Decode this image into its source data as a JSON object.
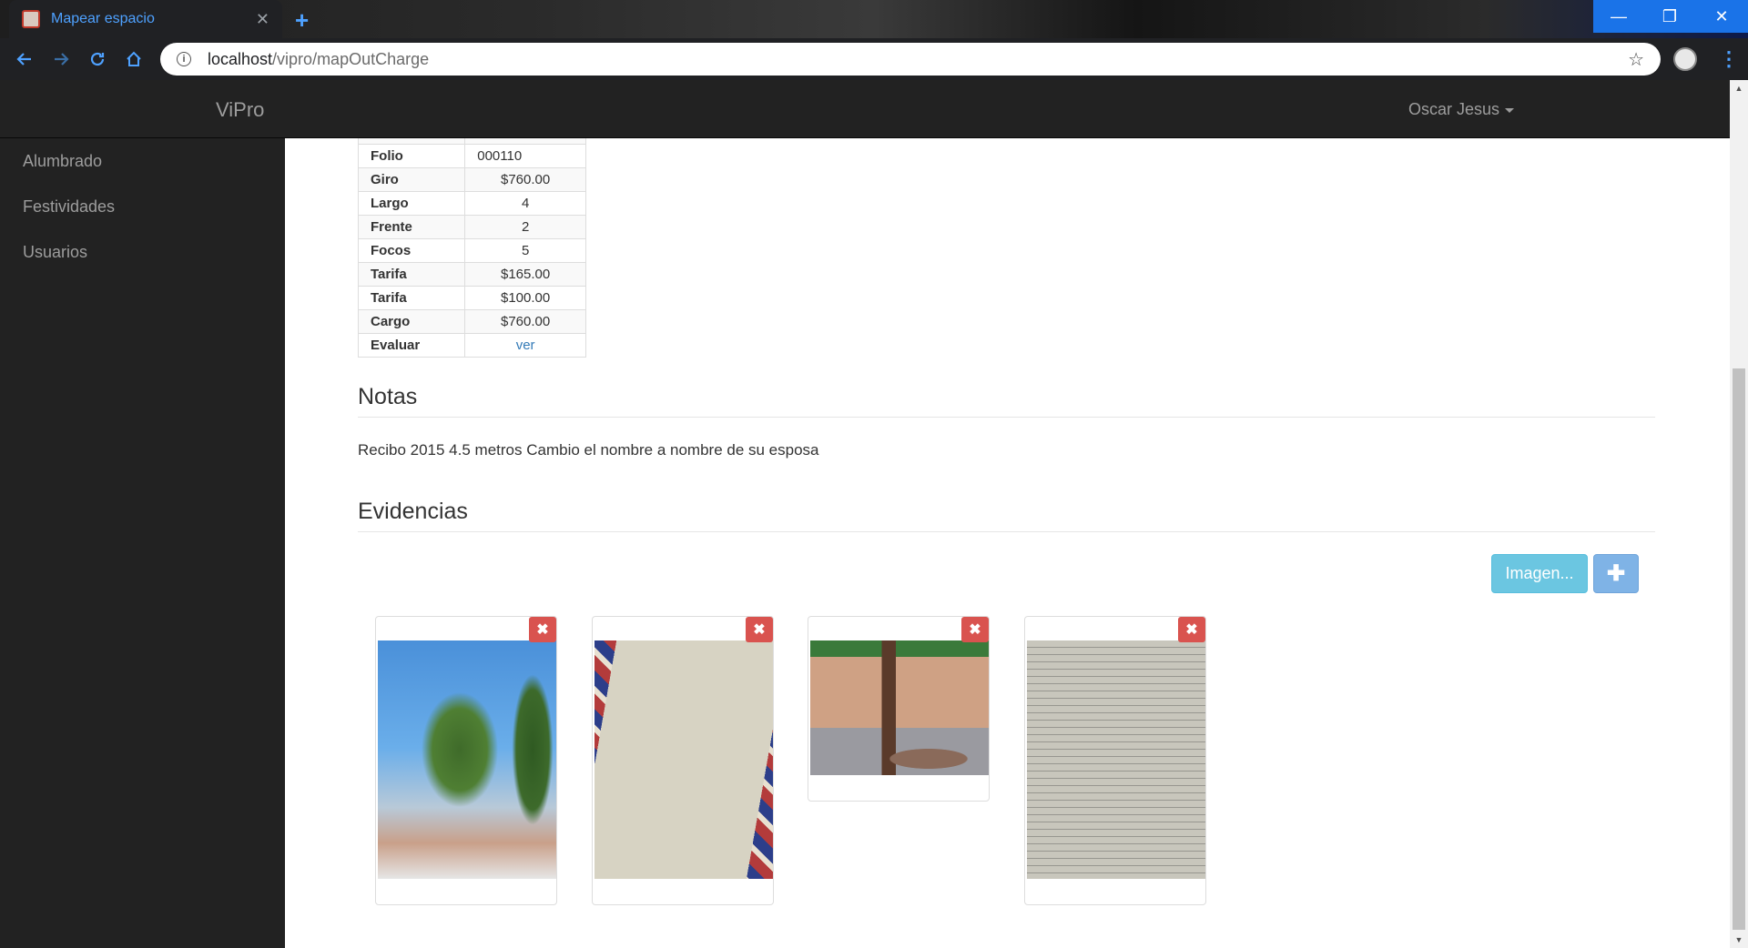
{
  "browser": {
    "tab_title": "Mapear espacio",
    "tab_close": "✕",
    "new_tab": "+",
    "url_host": "localhost",
    "url_path": "/vipro/mapOutCharge",
    "info_icon": "i",
    "star_icon": "☆",
    "window_controls": [
      "—",
      "❐",
      "✕"
    ]
  },
  "navbar": {
    "brand": "ViPro",
    "user": "Oscar Jesus"
  },
  "sidebar": {
    "items": [
      {
        "label": "Alumbrado"
      },
      {
        "label": "Festividades"
      },
      {
        "label": "Usuarios"
      }
    ]
  },
  "details": {
    "rows": [
      {
        "label": "Folio",
        "value": "000110"
      },
      {
        "label": "Giro",
        "value": "$760.00"
      },
      {
        "label": "Largo",
        "value": "4"
      },
      {
        "label": "Frente",
        "value": "2"
      },
      {
        "label": "Focos",
        "value": "5"
      },
      {
        "label": "Tarifa",
        "value": "$165.00"
      },
      {
        "label": "Tarifa",
        "value": "$100.00"
      },
      {
        "label": "Cargo",
        "value": "$760.00"
      },
      {
        "label": "Evaluar",
        "value": "ver"
      }
    ]
  },
  "notes": {
    "title": "Notas",
    "text": "Recibo 2015 4.5 metros Cambio el nombre a nombre de su esposa"
  },
  "evidence": {
    "title": "Evidencias",
    "image_button": "Imagen...",
    "add_button": "✚",
    "delete_label": "✖",
    "thumbnails": [
      {
        "kind": "tree-photo"
      },
      {
        "kind": "receipt-photo"
      },
      {
        "kind": "building-photo"
      },
      {
        "kind": "document-photo"
      }
    ]
  }
}
